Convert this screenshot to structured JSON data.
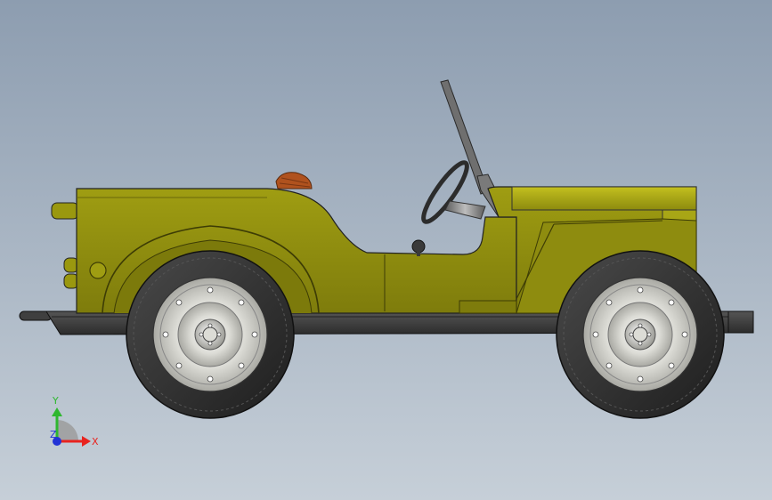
{
  "viewport": {
    "background_top": "#8d9db0",
    "background_bottom": "#c6cfd8"
  },
  "model": {
    "body_color": "#8c8a0e",
    "body_highlight": "#b5b31c",
    "body_dark": "#6f6d0a",
    "chassis_color": "#3a3a3a",
    "tire_color": "#2a2a2a",
    "rim_color": "#e4e4e0",
    "seat_color": "#b0521e"
  },
  "triad": {
    "x_label": "X",
    "y_label": "Y",
    "z_label": "Z",
    "x_color": "#e8231f",
    "y_color": "#2fb72f",
    "z_color": "#2233d6"
  }
}
